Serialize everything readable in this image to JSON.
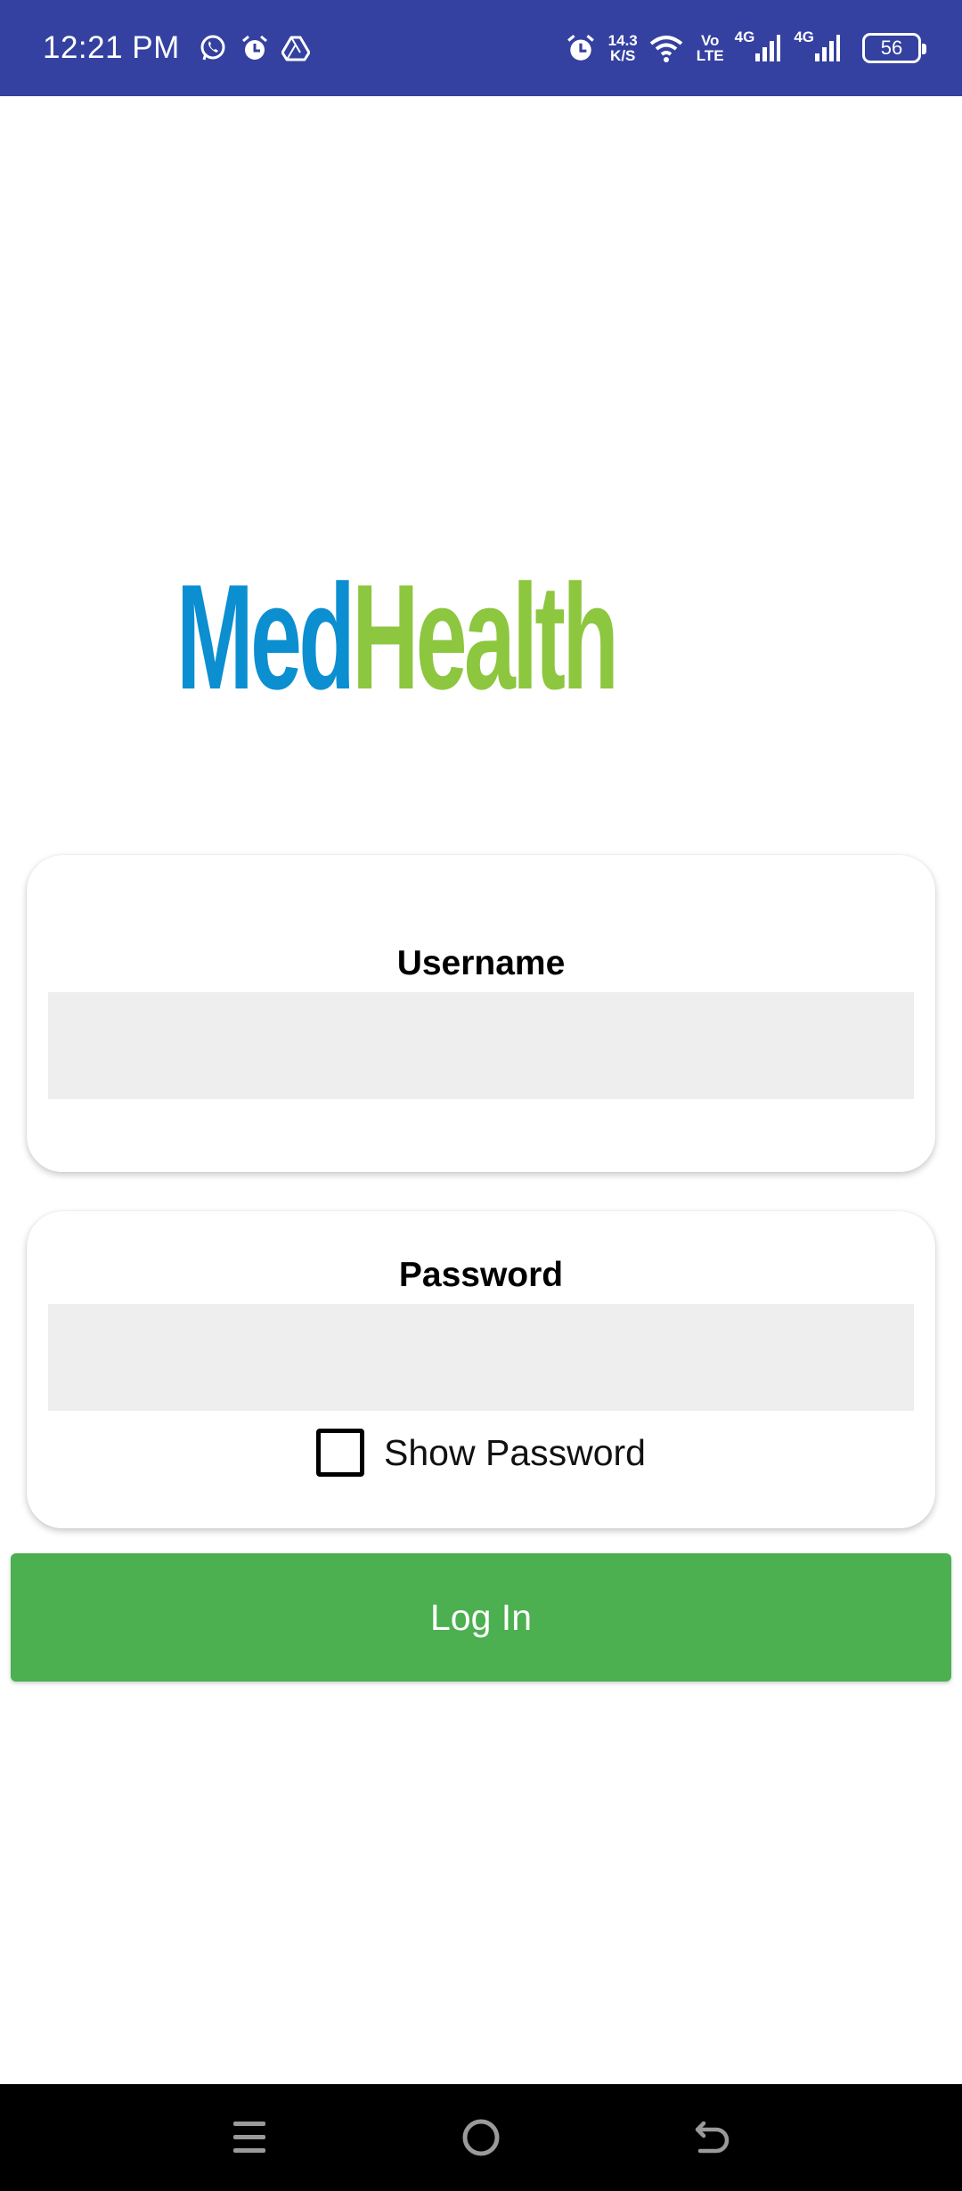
{
  "status_bar": {
    "time": "12:21 PM",
    "icons_left": [
      "whatsapp-icon",
      "alarm-icon",
      "drive-icon"
    ],
    "net_speed_value": "14.3",
    "net_speed_unit": "K/S",
    "volte_top": "Vo",
    "volte_bottom": "LTE",
    "sim1_label": "4G",
    "sim2_label": "4G",
    "battery": "56"
  },
  "logo": {
    "part1": "Med",
    "part2": "Health",
    "color_med": "#0b8fd0",
    "color_health": "#8dc63f"
  },
  "form": {
    "username_label": "Username",
    "username_value": "",
    "password_label": "Password",
    "password_value": "",
    "show_password_label": "Show Password",
    "show_password_checked": false,
    "login_label": "Log In"
  },
  "colors": {
    "status_bar": "#3441a0",
    "login_button": "#4caf50",
    "input_background": "#eeeeee"
  },
  "nav_bar": {
    "buttons": [
      "menu-icon",
      "home-icon",
      "back-icon"
    ]
  }
}
